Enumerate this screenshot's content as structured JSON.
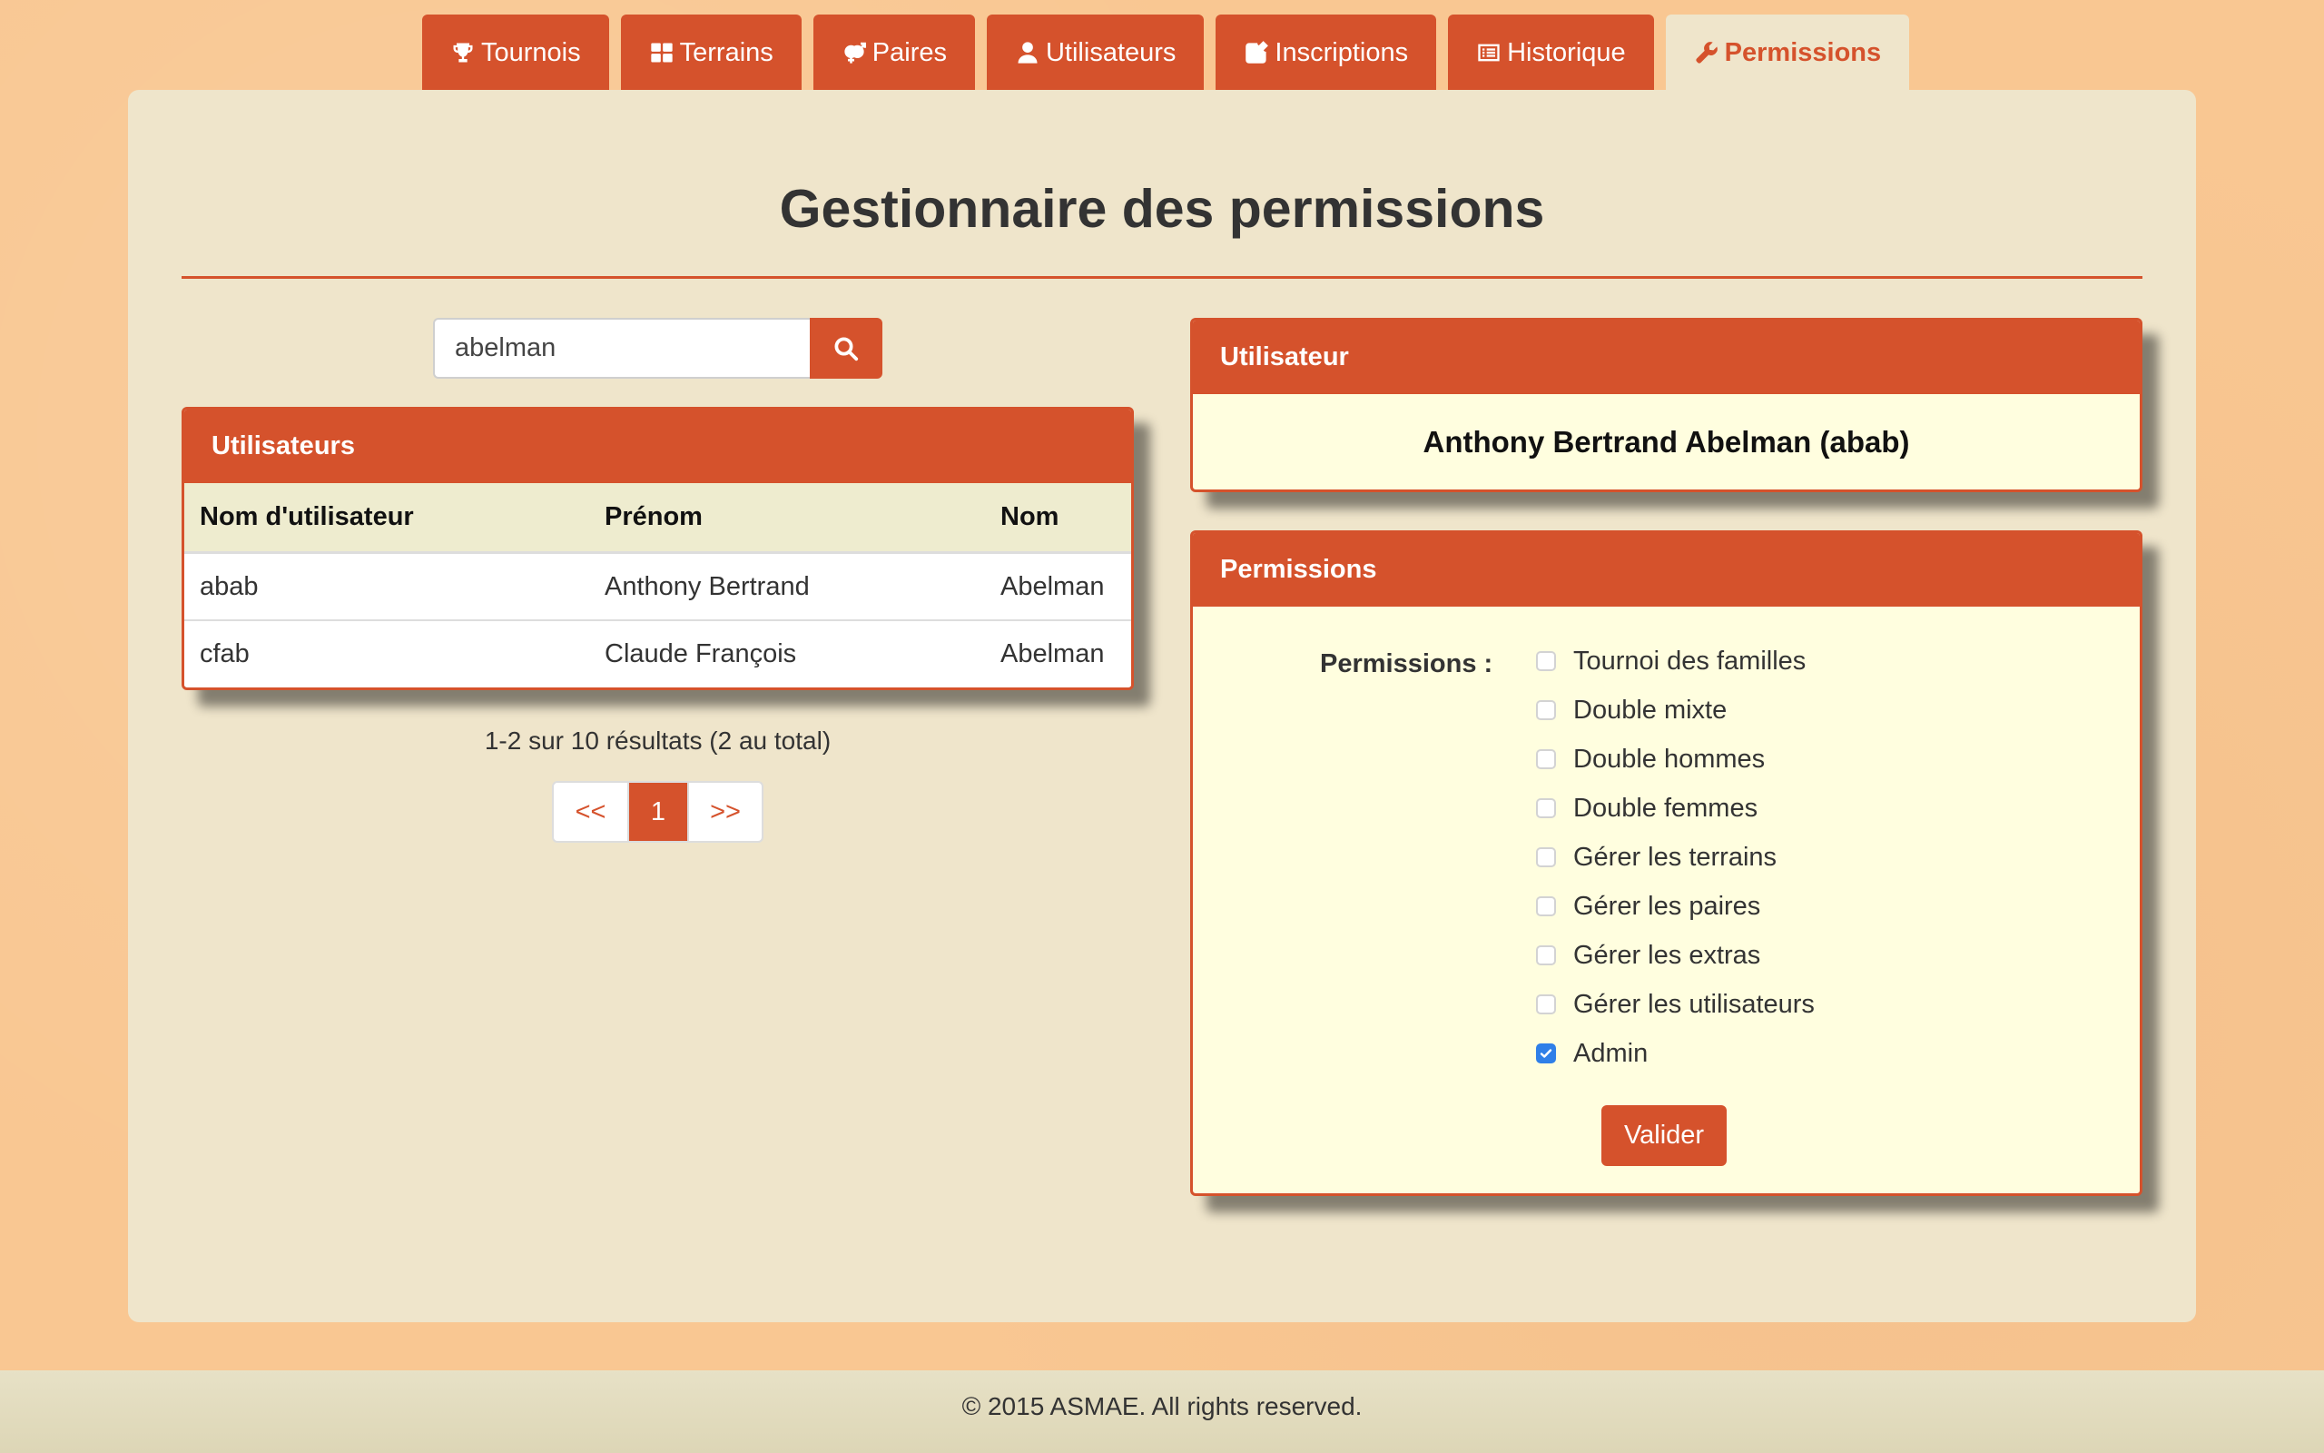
{
  "tabs": [
    {
      "label": "Tournois",
      "icon": "trophy-icon"
    },
    {
      "label": "Terrains",
      "icon": "grid-icon"
    },
    {
      "label": "Paires",
      "icon": "gender-icon"
    },
    {
      "label": "Utilisateurs",
      "icon": "user-icon"
    },
    {
      "label": "Inscriptions",
      "icon": "edit-icon"
    },
    {
      "label": "Historique",
      "icon": "list-icon"
    },
    {
      "label": "Permissions",
      "icon": "wrench-icon",
      "active": true
    }
  ],
  "page": {
    "title": "Gestionnaire des permissions"
  },
  "search": {
    "value": "abelman",
    "icon": "search-icon"
  },
  "users_panel": {
    "title": "Utilisateurs",
    "columns": [
      "Nom d'utilisateur",
      "Prénom",
      "Nom"
    ],
    "rows": [
      [
        "abab",
        "Anthony Bertrand",
        "Abelman"
      ],
      [
        "cfab",
        "Claude François",
        "Abelman"
      ]
    ]
  },
  "results": {
    "text": "1-2 sur 10 résultats (2 au total)"
  },
  "pagination": {
    "prev": "<<",
    "current": "1",
    "next": ">>"
  },
  "user_panel": {
    "title": "Utilisateur",
    "name": "Anthony Bertrand Abelman (abab)"
  },
  "permissions_panel": {
    "title": "Permissions",
    "label": "Permissions :",
    "items": [
      {
        "label": "Tournoi des familles",
        "checked": false
      },
      {
        "label": "Double mixte",
        "checked": false
      },
      {
        "label": "Double hommes",
        "checked": false
      },
      {
        "label": "Double femmes",
        "checked": false
      },
      {
        "label": "Gérer les terrains",
        "checked": false
      },
      {
        "label": "Gérer les paires",
        "checked": false
      },
      {
        "label": "Gérer les extras",
        "checked": false
      },
      {
        "label": "Gérer les utilisateurs",
        "checked": false
      },
      {
        "label": "Admin",
        "checked": true
      }
    ],
    "submit_label": "Valider"
  },
  "footer": {
    "text": "© 2015 ASMAE. All rights reserved."
  },
  "colors": {
    "accent": "#d5522c",
    "background": "#f9c792",
    "container": "#efe5cb",
    "panel_body": "#fffedf",
    "checkbox_checked": "#2f7fe8"
  }
}
